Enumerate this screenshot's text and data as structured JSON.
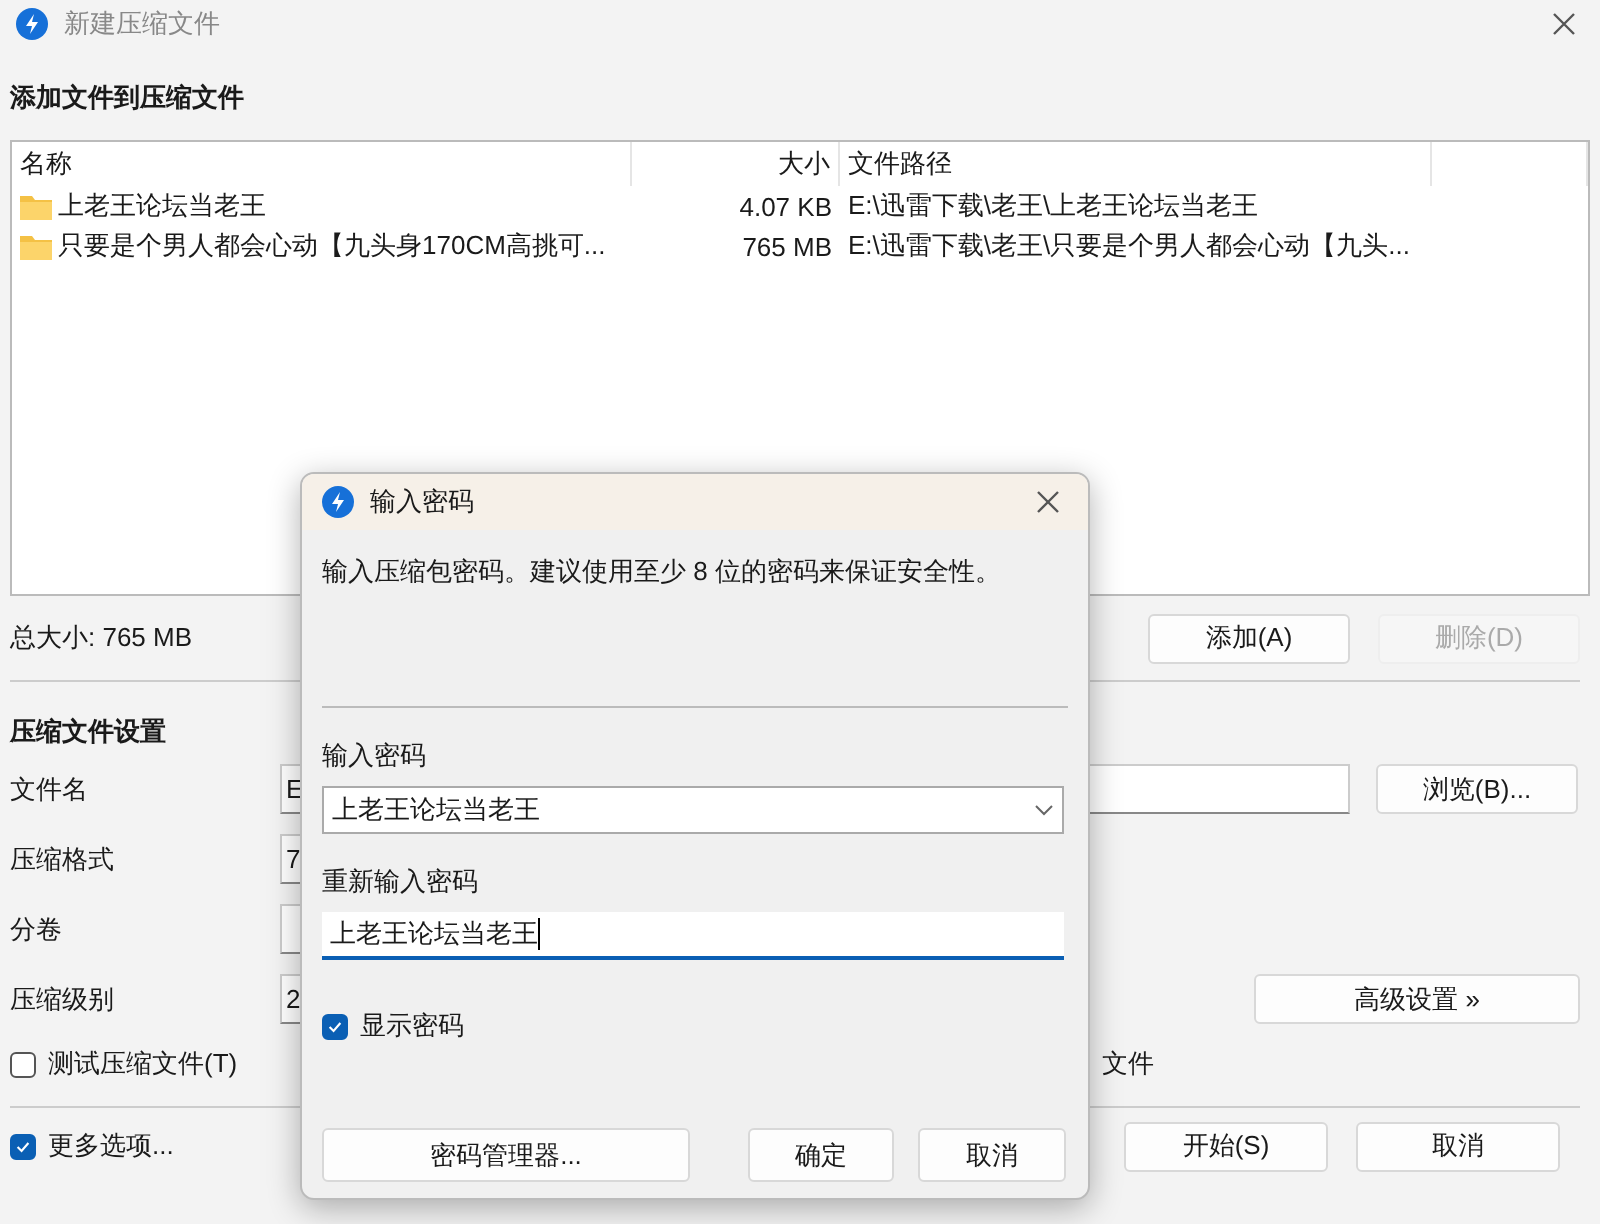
{
  "window": {
    "title": "新建压缩文件"
  },
  "files_section": {
    "heading": "添加文件到压缩文件",
    "columns": [
      "名称",
      "大小",
      "文件路径"
    ],
    "rows": [
      {
        "name": "上老王论坛当老王",
        "size": "4.07 KB",
        "path": "E:\\迅雷下载\\老王\\上老王论坛当老王"
      },
      {
        "name": "只要是个男人都会心动【九头身170CM高挑可...",
        "size": "765 MB",
        "path": "E:\\迅雷下载\\老王\\只要是个男人都会心动【九头..."
      }
    ]
  },
  "total_size": "总大小: 765 MB",
  "list_buttons": [
    {
      "label": "添加(A)",
      "disabled": false
    },
    {
      "label": "删除(D)",
      "disabled": true
    }
  ],
  "settings": {
    "heading": "压缩文件设置",
    "fields": [
      {
        "label": "文件名",
        "value": "E"
      },
      {
        "label": "压缩格式",
        "value": "7"
      },
      {
        "label": "分卷"
      },
      {
        "label": "压缩级别",
        "value": "2"
      }
    ],
    "browse_button": "浏览(B)...",
    "advanced_button": "高级设置 »"
  },
  "test_checkbox": {
    "label": "测试压缩文件(T)",
    "checked": false
  },
  "hidden_option_tail": "文件",
  "more_options": {
    "label": "更多选项...",
    "checked": true
  },
  "footer_buttons": [
    "开始(S)",
    "取消"
  ],
  "password_dialog": {
    "title": "输入密码",
    "message": "输入压缩包密码。建议使用至少 8 位的密码来保证安全性。",
    "password_label": "输入密码",
    "password_value": "上老王论坛当老王",
    "confirm_label": "重新输入密码",
    "confirm_value": "上老王论坛当老王",
    "show_password": {
      "label": "显示密码",
      "checked": true
    },
    "manager_button": "密码管理器...",
    "buttons": [
      "确定",
      "取消"
    ]
  }
}
